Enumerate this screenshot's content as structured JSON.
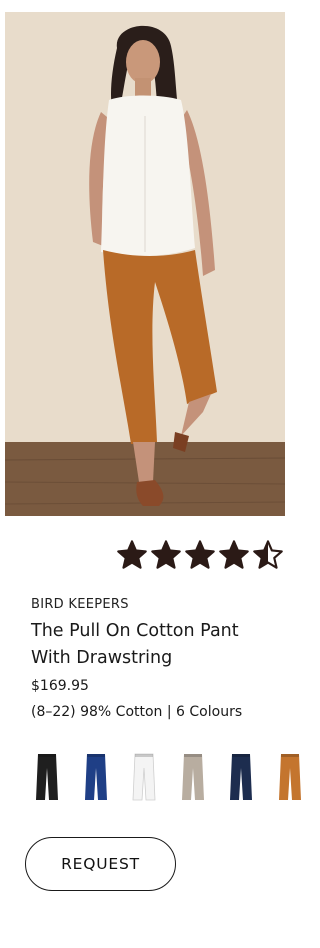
{
  "product": {
    "brand": "BIRD KEEPERS",
    "title": "The Pull On Cotton Pant With Drawstring",
    "price": "$169.95",
    "details": "(8–22) 98% Cotton | 6 Colours"
  },
  "rating": {
    "value": 4.5,
    "max": 5,
    "color": "#2b1a16"
  },
  "hero": {
    "image_subject": "model-wearing-tan-cropped-pants",
    "pants_color": "#b86a28",
    "top_color": "#f7f5f0",
    "background_color": "#e8dccb",
    "floor_color": "#7a5a40"
  },
  "swatches": [
    {
      "name": "black",
      "color": "#1f1f1f"
    },
    {
      "name": "navy",
      "color": "#1f3f86"
    },
    {
      "name": "white",
      "color": "#f4f4f4"
    },
    {
      "name": "stone",
      "color": "#b8ada0"
    },
    {
      "name": "dark-navy",
      "color": "#1d2d4f"
    },
    {
      "name": "tan",
      "color": "#c4752e"
    }
  ],
  "actions": {
    "request_label": "REQUEST"
  }
}
